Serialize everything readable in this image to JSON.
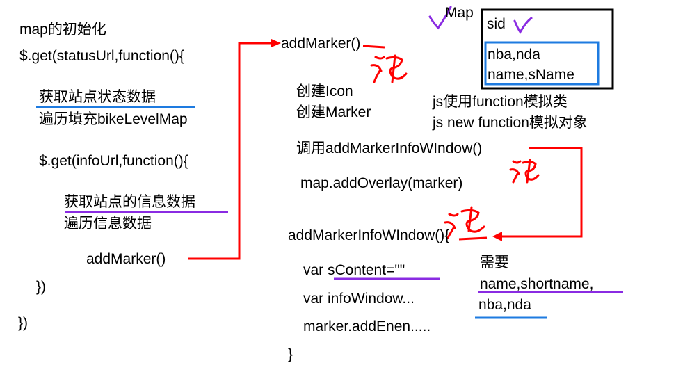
{
  "left": {
    "title": "map的初始化",
    "get_status": "$.get(statusUrl,function(){",
    "fetch_status": "获取站点状态数据",
    "fill_level_map": "遍历填充bikeLevelMap",
    "get_info": "$.get(infoUrl,function(){",
    "fetch_info": "获取站点的信息数据",
    "iterate_info": "遍历信息数据",
    "call_add_marker": "addMarker()",
    "close_inner": "})",
    "close_outer": "})"
  },
  "middle": {
    "add_marker": "addMarker()",
    "create_icon": "创建Icon",
    "create_marker": "创建Marker",
    "call_info_window": "调用addMarkerInfoWIndow()",
    "add_overlay": "map.addOverlay(marker)",
    "info_window_def": "addMarkerInfoWIndow(){",
    "var_content": "var sContent=\"\"",
    "var_info_window": "var infoWindow...",
    "add_event": "marker.addEnen.....",
    "close_brace": "}"
  },
  "right": {
    "map_label": "Map",
    "sid": "sid",
    "nba_nda": "nba,nda",
    "name_sname": "name,sName",
    "js_class": "js使用function模拟类",
    "js_object": "js new function模拟对象",
    "need": "需要",
    "need_names": "name,shortname,",
    "need_nba": "nba,nda"
  },
  "colors": {
    "arrow": "#ff0000",
    "blue_underline": "#1e7be0",
    "purple_underline": "#8a2be2",
    "box_border": "#000000",
    "inner_box": "#1e7be0"
  }
}
